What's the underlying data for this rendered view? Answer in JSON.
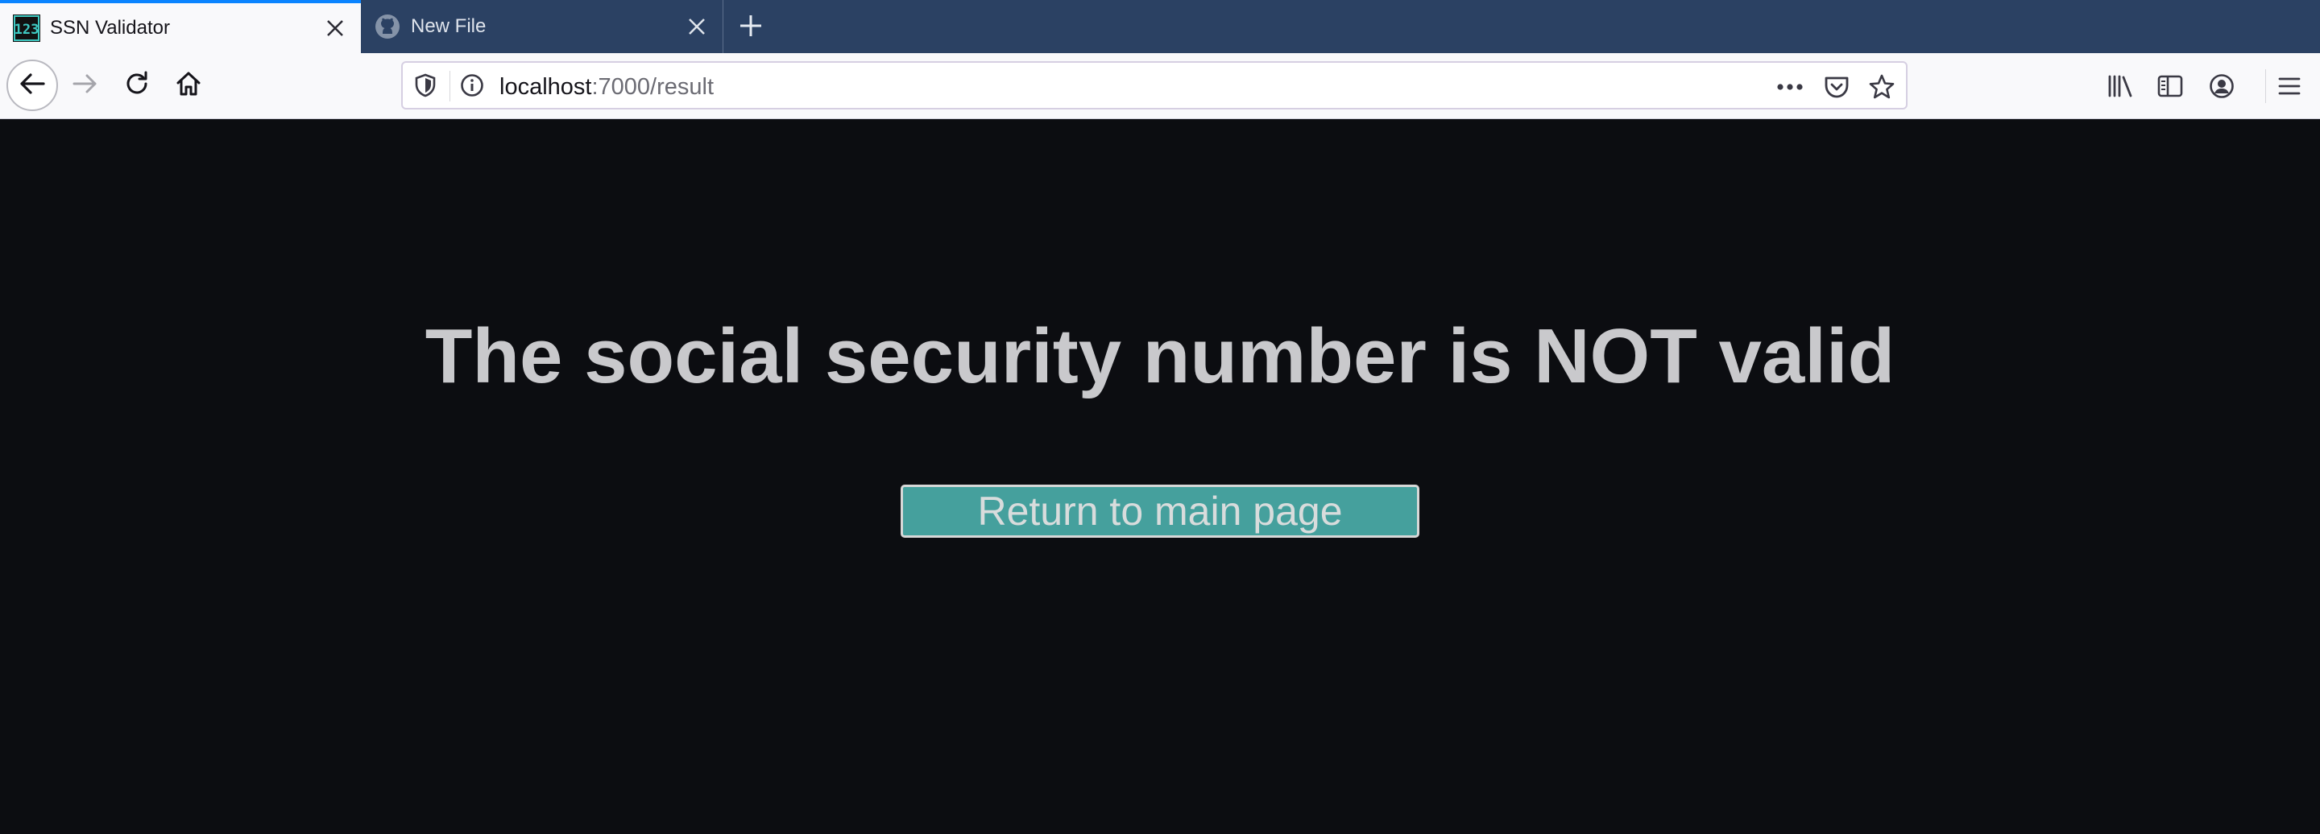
{
  "browser": {
    "tabs": [
      {
        "title": "SSN Validator",
        "favicon": "123-icon",
        "active": true
      },
      {
        "title": "New File",
        "favicon": "github-icon",
        "active": false
      }
    ],
    "url": {
      "host": "localhost",
      "path": ":7000/result"
    },
    "icons": {
      "back": "arrow-left-icon",
      "forward": "arrow-right-icon",
      "reload": "reload-icon",
      "home": "home-icon",
      "tracking": "shield-icon",
      "info": "info-icon",
      "more": "more-actions-icon",
      "pocket": "pocket-icon",
      "bookmark": "star-icon",
      "library": "library-icon",
      "sidebar": "sidebar-icon",
      "account": "account-icon",
      "menu": "hamburger-menu-icon"
    },
    "colors": {
      "tabstrip": "#2b4163",
      "active_tab_accent": "#0a84ff"
    }
  },
  "page": {
    "headline": "The social security number is NOT valid",
    "return_button": "Return to main page",
    "colors": {
      "background": "#0c0d11",
      "text": "#c9c9cc",
      "button": "#45a09d"
    }
  }
}
